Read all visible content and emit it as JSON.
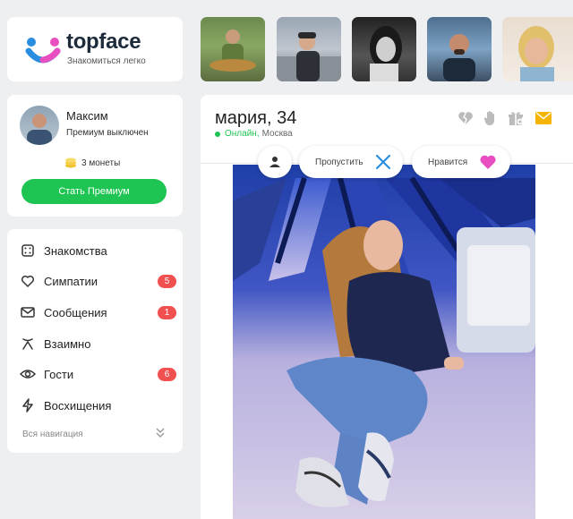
{
  "brand": {
    "name": "topface",
    "tagline": "Знакомиться легко"
  },
  "thumbnails": [
    {
      "icon": "man-with-fish-photo"
    },
    {
      "icon": "man-in-cap-photo"
    },
    {
      "icon": "woman-bw-photo"
    },
    {
      "icon": "man-with-beard-photo"
    },
    {
      "icon": "blonde-woman-photo"
    }
  ],
  "user": {
    "name": "Максим",
    "status": "Премиум выключен",
    "coins": "3 монеты",
    "premium_button": "Стать Премиум"
  },
  "nav": {
    "items": [
      {
        "label": "Знакомства",
        "icon": "dice-icon",
        "badge": ""
      },
      {
        "label": "Симпатии",
        "icon": "heart-icon",
        "badge": "5"
      },
      {
        "label": "Сообщения",
        "icon": "envelope-icon",
        "badge": "1"
      },
      {
        "label": "Взаимно",
        "icon": "mutual-icon",
        "badge": ""
      },
      {
        "label": "Гости",
        "icon": "eye-icon",
        "badge": "6"
      },
      {
        "label": "Восхищения",
        "icon": "lightning-icon",
        "badge": ""
      }
    ],
    "footer": "Вся навигация"
  },
  "profile": {
    "name_age": "мария, 34",
    "online": "Онлайн,",
    "city": "Москва"
  },
  "actions": {
    "skip": "Пропустить",
    "like": "Нравится"
  },
  "colors": {
    "accent_green": "#1fc552",
    "badge_red": "#f0504f",
    "skip_blue": "#2a8ee0",
    "like_pink": "#e94ec1",
    "mail_yellow": "#f5b400"
  }
}
